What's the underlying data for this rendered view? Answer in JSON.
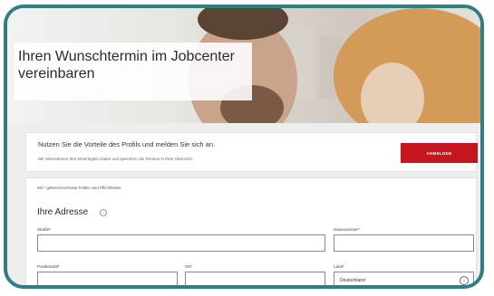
{
  "hero": {
    "title": "Ihren Wunschtermin im Jobcenter vereinbaren"
  },
  "login": {
    "title": "Nutzen Sie die Vorteile des Profils und melden Sie sich an.",
    "subtitle": "Wir übernehmen Ihre hinterlegten Daten und speichern die Termine in Ihrer Übersicht.",
    "button_label": "ANMELDEN"
  },
  "form": {
    "required_note": "Mit * gekennzeichnete Felder sind Pflichtfelder.",
    "section_title": "Ihre Adresse",
    "info_icon": "info-icon",
    "fields": {
      "street": {
        "label": "Straße*",
        "value": ""
      },
      "house_number": {
        "label": "Hausnummer*",
        "value": ""
      },
      "postal_code": {
        "label": "Postleitzahl*",
        "value": ""
      },
      "city": {
        "label": "Ort*",
        "value": ""
      },
      "country": {
        "label": "Land*",
        "value": "Deutschland",
        "icon": "chevron-down-icon"
      }
    }
  },
  "colors": {
    "frame": "#2f7d86",
    "accent_button": "#c4161c"
  }
}
